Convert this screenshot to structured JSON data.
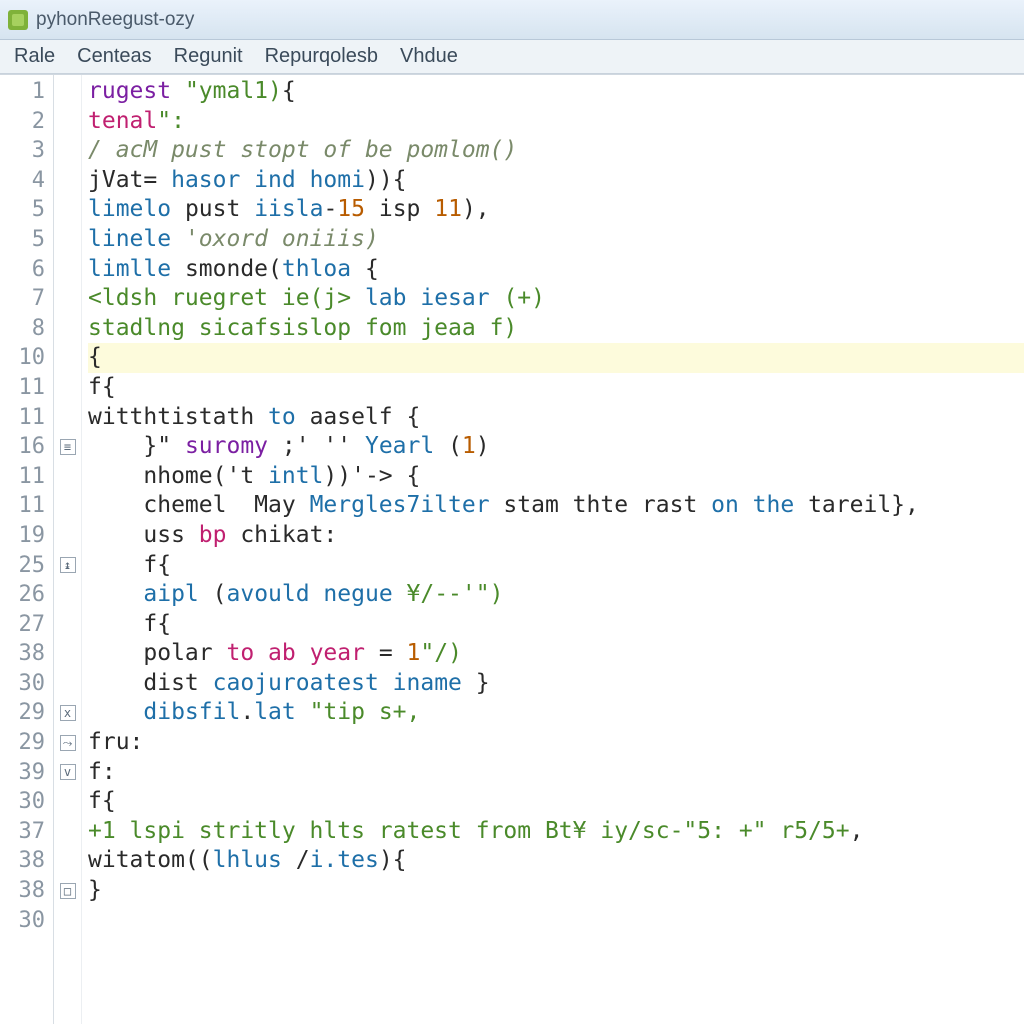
{
  "window": {
    "title": "pyhonReegust-ozy"
  },
  "menu": {
    "items": [
      "Rale",
      "Centeas",
      "Regunit",
      "Repurqolesb",
      "Vhdue"
    ]
  },
  "editor": {
    "highlighted_index": 9,
    "lines": [
      {
        "num": "1",
        "fold": "",
        "indent": 0,
        "tokens": [
          [
            "kw",
            "rugest "
          ],
          [
            "str",
            "\"ymal1)"
          ],
          [
            "def",
            "{"
          ]
        ]
      },
      {
        "num": "2",
        "fold": "",
        "indent": 0,
        "tokens": [
          [
            "kw2",
            "tenal"
          ],
          [
            "str",
            "\":"
          ],
          [
            "def",
            ""
          ]
        ]
      },
      {
        "num": "3",
        "fold": "",
        "indent": 0,
        "tokens": [
          [
            "cm",
            "/ acM pust stopt of be pomlom()"
          ]
        ]
      },
      {
        "num": "4",
        "fold": "",
        "indent": 0,
        "tokens": [
          [
            "def",
            "jVat= "
          ],
          [
            "fn",
            "hasor ind homi"
          ],
          [
            "def",
            "))"
          ],
          [
            "def",
            "{"
          ]
        ]
      },
      {
        "num": "5",
        "fold": "",
        "indent": 0,
        "tokens": [
          [
            "fn",
            "limelo "
          ],
          [
            "def",
            "pust "
          ],
          [
            "fn",
            "iisla"
          ],
          [
            "def",
            "-"
          ],
          [
            "num",
            "15"
          ],
          [
            "def",
            " isp "
          ],
          [
            "num",
            "11"
          ],
          [
            "def",
            "),"
          ]
        ]
      },
      {
        "num": "5",
        "fold": "",
        "indent": 0,
        "tokens": [
          [
            "fn",
            "linele "
          ],
          [
            "cm",
            "'oxord oniiis)"
          ]
        ]
      },
      {
        "num": "6",
        "fold": "",
        "indent": 0,
        "tokens": [
          [
            "fn",
            "limlle "
          ],
          [
            "def",
            "smonde("
          ],
          [
            "fn",
            "thloa"
          ],
          [
            "def",
            " {"
          ]
        ]
      },
      {
        "num": "7",
        "fold": "",
        "indent": 0,
        "tokens": [
          [
            "str",
            "<ldsh ruegret ie(j> "
          ],
          [
            "fn",
            "lab iesar "
          ],
          [
            "str",
            "(+)"
          ]
        ]
      },
      {
        "num": "8",
        "fold": "",
        "indent": 0,
        "tokens": [
          [
            "str",
            "stadlng sicafsislop fom jeaa f)"
          ]
        ]
      },
      {
        "num": "10",
        "fold": "",
        "indent": 0,
        "tokens": [
          [
            "def",
            "{"
          ]
        ]
      },
      {
        "num": "11",
        "fold": "",
        "indent": 0,
        "tokens": [
          [
            "def",
            "f{"
          ]
        ]
      },
      {
        "num": "11",
        "fold": "",
        "indent": 0,
        "tokens": [
          [
            "def",
            "witthtistath "
          ],
          [
            "fn",
            "to "
          ],
          [
            "def",
            "aaself {"
          ]
        ]
      },
      {
        "num": "16",
        "fold": "≡",
        "indent": 1,
        "tokens": [
          [
            "def",
            "}\" "
          ],
          [
            "kw",
            "suromy "
          ],
          [
            "def",
            ";' '' "
          ],
          [
            "fn",
            "Yearl"
          ],
          [
            "def",
            " ("
          ],
          [
            "num",
            "1"
          ],
          [
            "def",
            ")"
          ]
        ]
      },
      {
        "num": "11",
        "fold": "",
        "indent": 1,
        "tokens": [
          [
            "def",
            "nhome('t "
          ],
          [
            "fn",
            "intl"
          ],
          [
            "def",
            "))'-> {"
          ]
        ]
      },
      {
        "num": "11",
        "fold": "",
        "indent": 1,
        "tokens": [
          [
            "def",
            "chemel  May "
          ],
          [
            "fn",
            "Mergles7ilter"
          ],
          [
            "def",
            " stam thte rast "
          ],
          [
            "fn",
            "on the"
          ],
          [
            "def",
            " tareil},"
          ]
        ]
      },
      {
        "num": "19",
        "fold": "",
        "indent": 1,
        "tokens": [
          [
            "def",
            "uss "
          ],
          [
            "kw2",
            "bp"
          ],
          [
            "def",
            " chikat:"
          ]
        ]
      },
      {
        "num": "25",
        "fold": "↨",
        "indent": 1,
        "tokens": [
          [
            "def",
            "f{"
          ]
        ]
      },
      {
        "num": "26",
        "fold": "",
        "indent": 1,
        "tokens": [
          [
            "fn",
            "aipl "
          ],
          [
            "def",
            "("
          ],
          [
            "fn",
            "avould negue "
          ],
          [
            "str",
            "¥/--'\")"
          ]
        ]
      },
      {
        "num": "27",
        "fold": "",
        "indent": 1,
        "tokens": [
          [
            "def",
            "f{"
          ]
        ]
      },
      {
        "num": "38",
        "fold": "",
        "indent": 1,
        "tokens": [
          [
            "def",
            "polar "
          ],
          [
            "kw2",
            "to ab year "
          ],
          [
            "def",
            "= "
          ],
          [
            "num",
            "1"
          ],
          [
            "str",
            "\"/)"
          ]
        ]
      },
      {
        "num": "30",
        "fold": "",
        "indent": 1,
        "tokens": [
          [
            "def",
            "dist "
          ],
          [
            "fn",
            "caojuroatest iname"
          ],
          [
            "def",
            " }"
          ]
        ]
      },
      {
        "num": "29",
        "fold": "x",
        "indent": 1,
        "tokens": [
          [
            "fn",
            "dibsfil"
          ],
          [
            "def",
            "."
          ],
          [
            "fn",
            "lat "
          ],
          [
            "str",
            "\"tip s+,"
          ]
        ]
      },
      {
        "num": "29",
        "fold": "⤳",
        "indent": 0,
        "tokens": [
          [
            "def",
            "fru:"
          ]
        ]
      },
      {
        "num": "39",
        "fold": "v",
        "indent": 0,
        "tokens": [
          [
            "def",
            "f:"
          ]
        ]
      },
      {
        "num": "30",
        "fold": "",
        "indent": 0,
        "tokens": [
          [
            "def",
            "f{"
          ]
        ]
      },
      {
        "num": "37",
        "fold": "",
        "indent": 0,
        "tokens": [
          [
            "str",
            "+1 lspi stritly hlts ratest from Bt¥ iy/sc-\"5: +\" r5/5+"
          ],
          [
            "def",
            ","
          ]
        ]
      },
      {
        "num": "38",
        "fold": "",
        "indent": 0,
        "tokens": [
          [
            "def",
            "witatom(("
          ],
          [
            "fn",
            "lhlus "
          ],
          [
            "def",
            "/"
          ],
          [
            "fn",
            "i.tes"
          ],
          [
            "def",
            "){"
          ]
        ]
      },
      {
        "num": "38",
        "fold": "□",
        "indent": 0,
        "tokens": [
          [
            "def",
            "}"
          ]
        ]
      },
      {
        "num": "30",
        "fold": "",
        "indent": 0,
        "tokens": [
          [
            "def",
            ""
          ]
        ]
      }
    ]
  }
}
